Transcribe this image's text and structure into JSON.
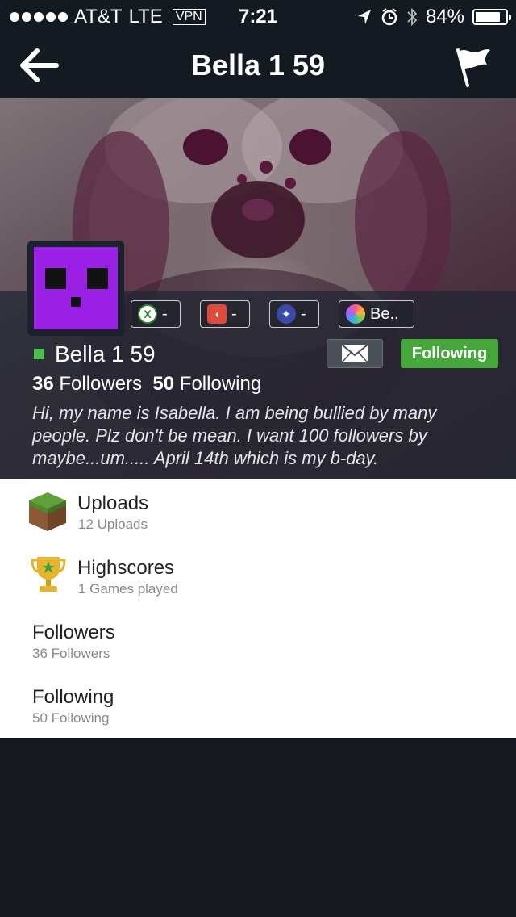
{
  "status_bar": {
    "carrier": "AT&T",
    "network": "LTE",
    "vpn": "VPN",
    "time": "7:21",
    "battery": "84%",
    "battery_level": 0.84
  },
  "nav": {
    "title": "Bella 1 59",
    "back_icon": "arrow-left-icon",
    "flag_icon": "flag-icon"
  },
  "profile": {
    "username": "Bella 1 59",
    "online_color": "#4ac04a",
    "platforms": [
      {
        "icon": "xbox-icon",
        "label": "-"
      },
      {
        "icon": "apple-game-center-icon",
        "label": "-"
      },
      {
        "icon": "playstation-icon",
        "label": "-"
      },
      {
        "icon": "game-center-icon",
        "label": "Be.."
      }
    ],
    "follow_button": "Following",
    "followers_count": "36",
    "followers_label": "Followers",
    "following_count": "50",
    "following_label": "Following",
    "bio": "Hi, my name is Isabella. I am being bullied by many people. Plz don't be mean. I want 100 followers by maybe...um..... April 14th which is my b-day."
  },
  "menu": [
    {
      "title": "Uploads",
      "subtitle": "12 Uploads",
      "icon": "grass-block-icon"
    },
    {
      "title": "Highscores",
      "subtitle": "1 Games played",
      "icon": "trophy-icon"
    },
    {
      "title": "Followers",
      "subtitle": "36 Followers"
    },
    {
      "title": "Following",
      "subtitle": "50 Following"
    }
  ]
}
